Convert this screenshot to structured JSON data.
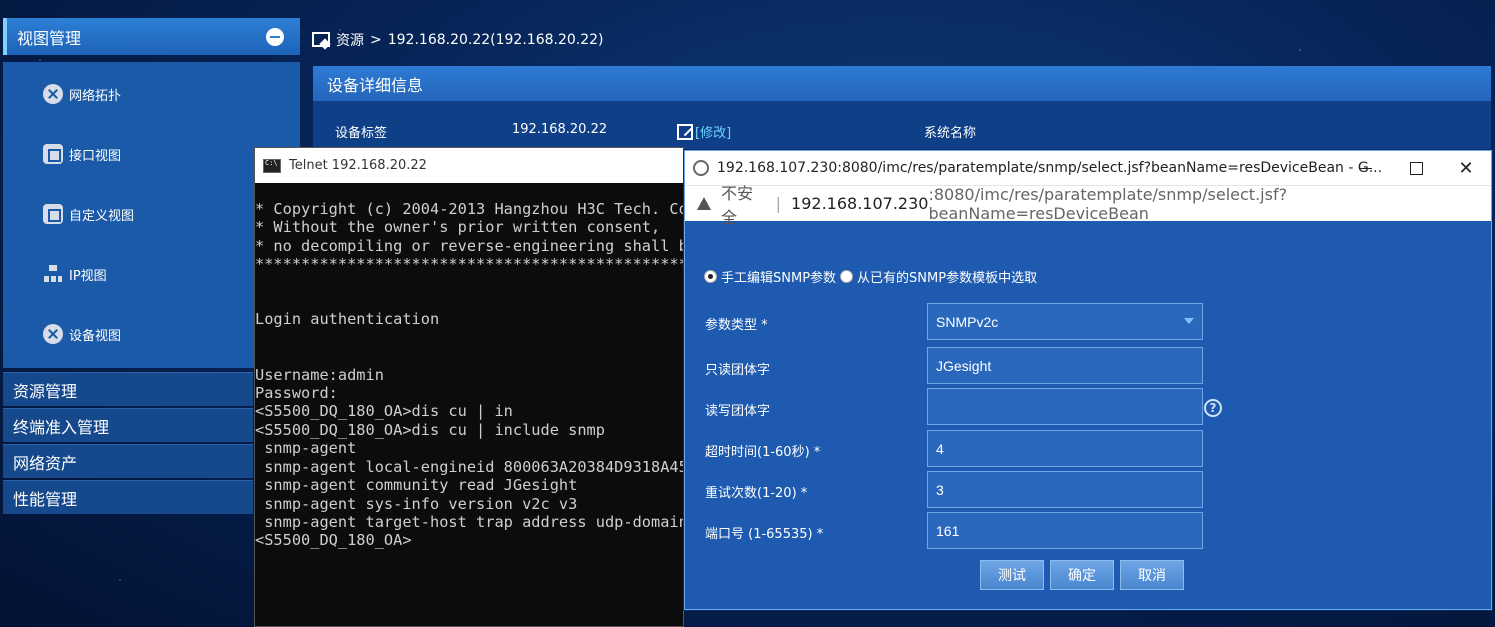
{
  "sidebar": {
    "header": "视图管理",
    "items": [
      {
        "label": "网络拓扑",
        "icon": "topology-icon"
      },
      {
        "label": "接口视图",
        "icon": "interface-icon"
      },
      {
        "label": "自定义视图",
        "icon": "custom-view-icon"
      },
      {
        "label": "IP视图",
        "icon": "ip-view-icon"
      },
      {
        "label": "设备视图",
        "icon": "device-view-icon"
      }
    ],
    "groups": [
      "资源管理",
      "终端准入管理",
      "网络资产",
      "性能管理"
    ]
  },
  "breadcrumb": {
    "root": "资源",
    "sep": ">",
    "current": "192.168.20.22(192.168.20.22)"
  },
  "detail": {
    "title": "设备详细信息",
    "label_key": "设备标签",
    "label_value": "192.168.20.22",
    "modify": "[修改]",
    "sysname_key": "系统名称"
  },
  "telnet": {
    "title": "Telnet 192.168.20.22",
    "lines": [
      "* Copyright (c) 2004-2013 Hangzhou H3C Tech. Co",
      "* Without the owner's prior written consent,",
      "* no decompiling or reverse-engineering shall b",
      "************************************************",
      "",
      "",
      "Login authentication",
      "",
      "",
      "Username:admin",
      "Password:",
      "<S5500_DQ_180_OA>dis cu | in",
      "<S5500_DQ_180_OA>dis cu | include snmp",
      " snmp-agent",
      " snmp-agent local-engineid 800063A20384D9318A45",
      " snmp-agent community read JGesight",
      " snmp-agent sys-info version v2c v3",
      " snmp-agent target-host trap address udp-domain",
      "<S5500_DQ_180_OA>"
    ]
  },
  "popup": {
    "title": "192.168.107.230:8080/imc/res/paratemplate/snmp/select.jsf?beanName=resDeviceBean - G...",
    "insecure": "不安全",
    "sep": "|",
    "url_host": "192.168.107.230",
    "url_path": ":8080/imc/res/paratemplate/snmp/select.jsf?beanName=resDeviceBean",
    "radio_manual": "手工编辑SNMP参数",
    "radio_template": "从已有的SNMP参数模板中选取",
    "fields": {
      "type_label": "参数类型 *",
      "type_value": "SNMPv2c",
      "read_label": "只读团体字",
      "read_value": "JGesight",
      "write_label": "读写团体字",
      "write_value": "",
      "timeout_label": "超时时间(1-60秒) *",
      "timeout_value": "4",
      "retry_label": "重试次数(1-20) *",
      "retry_value": "3",
      "port_label": "端口号 (1-65535) *",
      "port_value": "161"
    },
    "help": "?",
    "buttons": {
      "test": "测试",
      "ok": "确定",
      "cancel": "取消"
    },
    "win_close": "✕"
  }
}
